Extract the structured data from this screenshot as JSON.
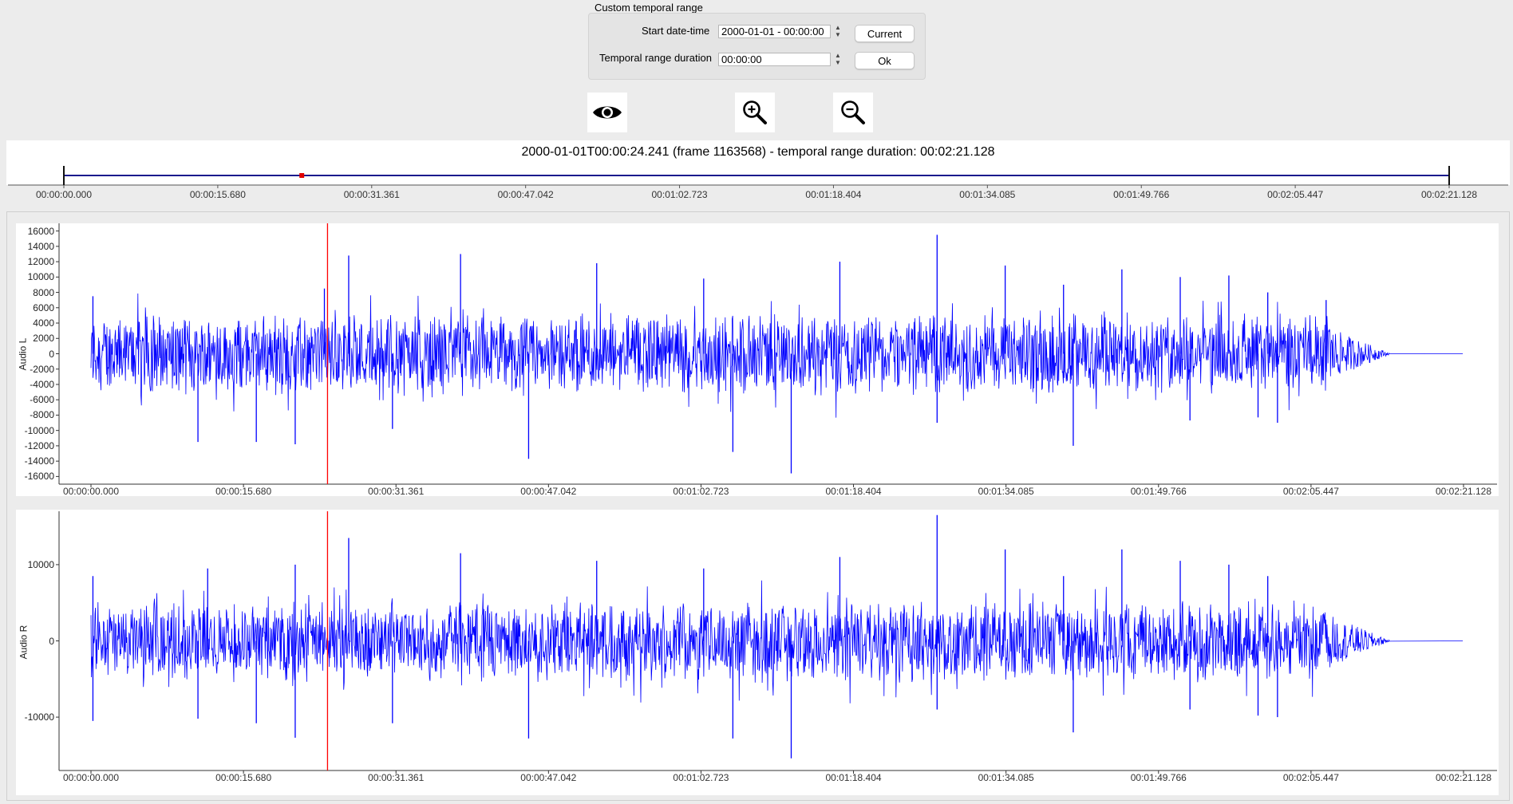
{
  "custom_range": {
    "title": "Custom temporal range",
    "start_label": "Start date-time",
    "start_value": "2000-01-01 - 00:00:00",
    "duration_label": "Temporal range duration",
    "duration_value": "00:00:00",
    "current_button": "Current",
    "ok_button": "Ok"
  },
  "toolbar": {
    "icons": [
      "eye-icon",
      "zoom-in-icon",
      "zoom-out-icon"
    ]
  },
  "timeline": {
    "status": "2000-01-01T00:00:24.241 (frame 1163568) - temporal range duration: 00:02:21.128",
    "cursor_seconds": 24.241,
    "duration_seconds": 141.128,
    "tick_labels": [
      "00:00:00.000",
      "00:00:15.680",
      "00:00:31.361",
      "00:00:47.042",
      "00:01:02.723",
      "00:01:18.404",
      "00:01:34.085",
      "00:01:49.766",
      "00:02:05.447",
      "00:02:21.128"
    ]
  },
  "colors": {
    "waveform": "#0000ff",
    "cursor": "#ff0000",
    "timeline_bar": "#1a1a8c",
    "marker": "#e00000"
  },
  "chart_data": [
    {
      "type": "line",
      "ylabel": "Audio L",
      "ylim": [
        -17000,
        17000
      ],
      "yticks": [
        "16000",
        "14000",
        "12000",
        "10000",
        "8000",
        "6000",
        "4000",
        "2000",
        "0",
        "-2000",
        "-4000",
        "-6000",
        "-8000",
        "-10000",
        "-12000",
        "-14000",
        "-16000"
      ],
      "ytick_values": [
        16000,
        14000,
        12000,
        10000,
        8000,
        6000,
        4000,
        2000,
        0,
        -2000,
        -4000,
        -6000,
        -8000,
        -10000,
        -12000,
        -14000,
        -16000
      ],
      "x_tick_labels": [
        "00:00:00.000",
        "00:00:15.680",
        "00:00:31.361",
        "00:00:47.042",
        "00:01:02.723",
        "00:01:18.404",
        "00:01:34.085",
        "00:01:49.766",
        "00:02:05.447",
        "00:02:21.128"
      ],
      "peaks_positive": [
        [
          0.2,
          7500
        ],
        [
          24.0,
          8500
        ],
        [
          26.5,
          12800
        ],
        [
          38,
          13000
        ],
        [
          52,
          11800
        ],
        [
          63,
          9800
        ],
        [
          77,
          12000
        ],
        [
          87,
          15500
        ],
        [
          94,
          11500
        ],
        [
          100,
          9000
        ],
        [
          106,
          11000
        ],
        [
          112,
          10000
        ],
        [
          117,
          10200
        ],
        [
          121,
          8000
        ],
        [
          127,
          7000
        ]
      ],
      "peaks_negative": [
        [
          11,
          -11500
        ],
        [
          17,
          -11500
        ],
        [
          21,
          -11800
        ],
        [
          31,
          -9800
        ],
        [
          45,
          -13700
        ],
        [
          66,
          -12800
        ],
        [
          72,
          -15600
        ],
        [
          87,
          -9000
        ],
        [
          101,
          -12000
        ],
        [
          113,
          -8700
        ],
        [
          120,
          -8300
        ],
        [
          122,
          -9000
        ]
      ],
      "cursor_seconds": 24.241,
      "fade_start_seconds": 127.5,
      "silence_start_seconds": 133.5
    },
    {
      "type": "line",
      "ylabel": "Audio R",
      "ylim": [
        -17000,
        17000
      ],
      "yticks": [
        "10000",
        "0",
        "-10000"
      ],
      "ytick_values": [
        10000,
        0,
        -10000
      ],
      "x_tick_labels": [
        "00:00:00.000",
        "00:00:15.680",
        "00:00:31.361",
        "00:00:47.042",
        "00:01:02.723",
        "00:01:18.404",
        "00:01:34.085",
        "00:01:49.766",
        "00:02:05.447",
        "00:02:21.128"
      ],
      "peaks_positive": [
        [
          0.2,
          8500
        ],
        [
          12,
          9500
        ],
        [
          21,
          10000
        ],
        [
          26.5,
          13500
        ],
        [
          38,
          11500
        ],
        [
          52,
          10500
        ],
        [
          63,
          9500
        ],
        [
          77,
          11000
        ],
        [
          87,
          16500
        ],
        [
          94,
          12000
        ],
        [
          100,
          8500
        ],
        [
          106,
          12000
        ],
        [
          112,
          10500
        ],
        [
          117,
          10000
        ],
        [
          121,
          8500
        ]
      ],
      "peaks_negative": [
        [
          0.2,
          -10500
        ],
        [
          11,
          -10200
        ],
        [
          17,
          -10800
        ],
        [
          21,
          -12700
        ],
        [
          31,
          -10800
        ],
        [
          45,
          -12800
        ],
        [
          66,
          -12800
        ],
        [
          72,
          -15400
        ],
        [
          87,
          -9000
        ],
        [
          101,
          -12000
        ],
        [
          113,
          -9000
        ],
        [
          120,
          -9800
        ],
        [
          122,
          -10000
        ]
      ],
      "cursor_seconds": 24.241,
      "fade_start_seconds": 127.5,
      "silence_start_seconds": 133.5
    }
  ]
}
